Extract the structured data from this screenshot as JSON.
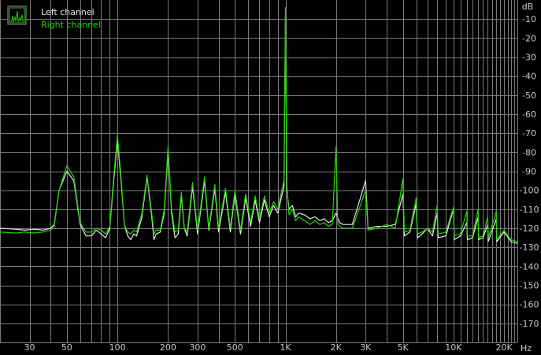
{
  "chart_data": {
    "type": "line",
    "title": "",
    "xlabel": "Hz",
    "ylabel": "dB",
    "x_scale": "log",
    "xlim": [
      20,
      24000
    ],
    "ylim": [
      -180,
      0
    ],
    "grid": true,
    "legend_position": "top-left",
    "background_color": "#000000",
    "grid_color": "#7a7a7a",
    "x_ticks": [
      30,
      50,
      100,
      200,
      300,
      500,
      1000,
      2000,
      3000,
      5000,
      10000,
      20000
    ],
    "x_tick_labels": [
      "30",
      "50",
      "100",
      "200",
      "300",
      "500",
      "1K",
      "2K",
      "3K",
      "5K",
      "10K",
      "20K"
    ],
    "y_ticks": [
      -10,
      -20,
      -30,
      -40,
      -50,
      -60,
      -70,
      -80,
      -90,
      -100,
      -110,
      -120,
      -130,
      -140,
      -150,
      -160,
      -170
    ],
    "y_tick_labels": [
      "-10",
      "-20",
      "-30",
      "-40",
      "-50",
      "-60",
      "-70",
      "-80",
      "-90",
      "-100",
      "-110",
      "-120",
      "-130",
      "-140",
      "-150",
      "-160",
      "-170"
    ],
    "legend": {
      "icon": "spectrum-icon",
      "entries": [
        "Left channel",
        "Right channel"
      ]
    },
    "series": [
      {
        "name": "Left channel",
        "color": "#e8e8e8",
        "points": [
          [
            20,
            -120
          ],
          [
            25,
            -120.5
          ],
          [
            28,
            -121
          ],
          [
            32,
            -120.5
          ],
          [
            36,
            -121
          ],
          [
            40,
            -120
          ],
          [
            42,
            -118
          ],
          [
            45,
            -100
          ],
          [
            50,
            -90
          ],
          [
            55,
            -95
          ],
          [
            60,
            -118
          ],
          [
            65,
            -124
          ],
          [
            70,
            -124
          ],
          [
            75,
            -121
          ],
          [
            80,
            -123
          ],
          [
            85,
            -125
          ],
          [
            90,
            -120
          ],
          [
            95,
            -95
          ],
          [
            100,
            -74
          ],
          [
            105,
            -95
          ],
          [
            110,
            -118
          ],
          [
            115,
            -124
          ],
          [
            120,
            -126
          ],
          [
            125,
            -123
          ],
          [
            130,
            -124
          ],
          [
            140,
            -114
          ],
          [
            150,
            -93
          ],
          [
            160,
            -114
          ],
          [
            165,
            -126
          ],
          [
            170,
            -123
          ],
          [
            180,
            -122
          ],
          [
            190,
            -112
          ],
          [
            200,
            -79
          ],
          [
            210,
            -112
          ],
          [
            220,
            -125
          ],
          [
            230,
            -123
          ],
          [
            240,
            -103
          ],
          [
            250,
            -120
          ],
          [
            260,
            -124
          ],
          [
            280,
            -98
          ],
          [
            300,
            -123
          ],
          [
            330,
            -95
          ],
          [
            350,
            -121
          ],
          [
            380,
            -99
          ],
          [
            400,
            -122
          ],
          [
            440,
            -101
          ],
          [
            470,
            -122
          ],
          [
            500,
            -102
          ],
          [
            540,
            -123
          ],
          [
            580,
            -104
          ],
          [
            620,
            -119
          ],
          [
            660,
            -105
          ],
          [
            700,
            -117
          ],
          [
            750,
            -105
          ],
          [
            800,
            -114
          ],
          [
            850,
            -108
          ],
          [
            900,
            -112
          ],
          [
            950,
            -103
          ],
          [
            980,
            -98
          ],
          [
            1000,
            -8
          ],
          [
            1020,
            -100
          ],
          [
            1050,
            -110
          ],
          [
            1100,
            -108
          ],
          [
            1150,
            -114
          ],
          [
            1200,
            -112
          ],
          [
            1300,
            -113
          ],
          [
            1400,
            -115
          ],
          [
            1500,
            -114
          ],
          [
            1600,
            -116
          ],
          [
            1700,
            -115
          ],
          [
            1800,
            -117
          ],
          [
            1900,
            -116
          ],
          [
            2000,
            -112
          ],
          [
            2100,
            -117
          ],
          [
            2200,
            -118
          ],
          [
            2500,
            -118
          ],
          [
            3000,
            -95
          ],
          [
            3100,
            -120
          ],
          [
            3500,
            -119
          ],
          [
            4000,
            -119
          ],
          [
            4500,
            -118
          ],
          [
            5000,
            -102
          ],
          [
            5100,
            -124
          ],
          [
            5500,
            -122
          ],
          [
            6000,
            -107
          ],
          [
            6100,
            -125
          ],
          [
            6500,
            -123
          ],
          [
            7000,
            -120
          ],
          [
            7500,
            -124
          ],
          [
            8000,
            -112
          ],
          [
            8100,
            -125
          ],
          [
            9000,
            -124
          ],
          [
            10000,
            -110
          ],
          [
            10100,
            -126
          ],
          [
            11000,
            -124
          ],
          [
            12000,
            -117
          ],
          [
            12100,
            -126
          ],
          [
            13000,
            -125
          ],
          [
            14000,
            -114
          ],
          [
            14100,
            -126
          ],
          [
            15000,
            -125
          ],
          [
            16000,
            -118
          ],
          [
            16100,
            -127
          ],
          [
            18000,
            -115
          ],
          [
            18100,
            -127
          ],
          [
            20000,
            -122
          ],
          [
            22000,
            -127
          ],
          [
            24000,
            -128
          ]
        ]
      },
      {
        "name": "Right channel",
        "color": "#22d400",
        "points": [
          [
            20,
            -122
          ],
          [
            25,
            -122.5
          ],
          [
            28,
            -122
          ],
          [
            32,
            -122.5
          ],
          [
            36,
            -122
          ],
          [
            40,
            -121
          ],
          [
            42,
            -119
          ],
          [
            45,
            -100
          ],
          [
            50,
            -87
          ],
          [
            55,
            -93
          ],
          [
            60,
            -117
          ],
          [
            65,
            -122
          ],
          [
            70,
            -122
          ],
          [
            75,
            -120
          ],
          [
            80,
            -121
          ],
          [
            85,
            -123
          ],
          [
            90,
            -119
          ],
          [
            95,
            -93
          ],
          [
            100,
            -71
          ],
          [
            105,
            -93
          ],
          [
            110,
            -118
          ],
          [
            115,
            -122
          ],
          [
            120,
            -123
          ],
          [
            125,
            -121
          ],
          [
            130,
            -122
          ],
          [
            140,
            -112
          ],
          [
            150,
            -92
          ],
          [
            160,
            -112
          ],
          [
            165,
            -123
          ],
          [
            170,
            -121
          ],
          [
            180,
            -121
          ],
          [
            190,
            -110
          ],
          [
            200,
            -77
          ],
          [
            210,
            -110
          ],
          [
            220,
            -122
          ],
          [
            230,
            -121
          ],
          [
            240,
            -101
          ],
          [
            250,
            -120
          ],
          [
            260,
            -122
          ],
          [
            280,
            -96
          ],
          [
            300,
            -121
          ],
          [
            330,
            -93
          ],
          [
            350,
            -120
          ],
          [
            380,
            -97
          ],
          [
            400,
            -120
          ],
          [
            440,
            -99
          ],
          [
            470,
            -120
          ],
          [
            500,
            -100
          ],
          [
            540,
            -121
          ],
          [
            580,
            -102
          ],
          [
            620,
            -117
          ],
          [
            660,
            -103
          ],
          [
            700,
            -115
          ],
          [
            750,
            -103
          ],
          [
            800,
            -112
          ],
          [
            850,
            -106
          ],
          [
            900,
            -110
          ],
          [
            950,
            -100
          ],
          [
            980,
            -95
          ],
          [
            1000,
            -4
          ],
          [
            1020,
            -98
          ],
          [
            1050,
            -113
          ],
          [
            1100,
            -110
          ],
          [
            1150,
            -116
          ],
          [
            1200,
            -114
          ],
          [
            1300,
            -116
          ],
          [
            1400,
            -118
          ],
          [
            1500,
            -116
          ],
          [
            1600,
            -118
          ],
          [
            1700,
            -117
          ],
          [
            1800,
            -119
          ],
          [
            1900,
            -118
          ],
          [
            2000,
            -77
          ],
          [
            2050,
            -118
          ],
          [
            2200,
            -120
          ],
          [
            2500,
            -120
          ],
          [
            3000,
            -100
          ],
          [
            3100,
            -121
          ],
          [
            3500,
            -120
          ],
          [
            4000,
            -118
          ],
          [
            4500,
            -120
          ],
          [
            5000,
            -94
          ],
          [
            5100,
            -122
          ],
          [
            5500,
            -121
          ],
          [
            6000,
            -104
          ],
          [
            6100,
            -123
          ],
          [
            6500,
            -122
          ],
          [
            7000,
            -120
          ],
          [
            7500,
            -122
          ],
          [
            8000,
            -108
          ],
          [
            8100,
            -123
          ],
          [
            9000,
            -122
          ],
          [
            10000,
            -109
          ],
          [
            10100,
            -124
          ],
          [
            11000,
            -123
          ],
          [
            12000,
            -111
          ],
          [
            12100,
            -124
          ],
          [
            13000,
            -124
          ],
          [
            14000,
            -110
          ],
          [
            14100,
            -125
          ],
          [
            15000,
            -124
          ],
          [
            16000,
            -114
          ],
          [
            16100,
            -125
          ],
          [
            18000,
            -111
          ],
          [
            18100,
            -126
          ],
          [
            20000,
            -121
          ],
          [
            22000,
            -126
          ],
          [
            24000,
            -127
          ]
        ]
      }
    ]
  }
}
